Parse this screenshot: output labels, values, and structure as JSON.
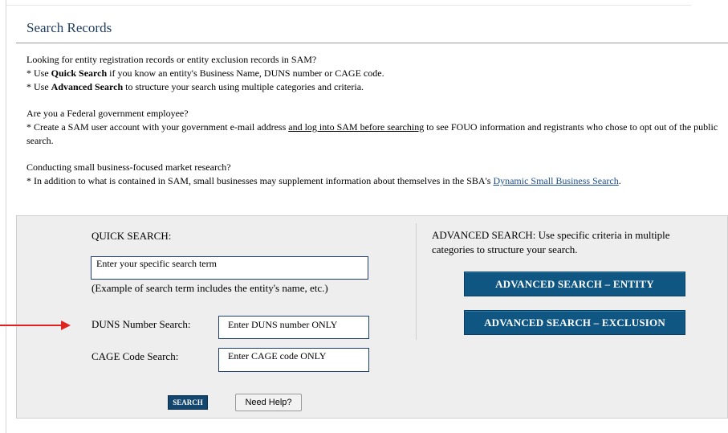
{
  "page": {
    "title": "Search Records"
  },
  "intro": {
    "line1": "Looking for entity registration records or entity exclusion records in SAM?",
    "quick_prefix": "* Use ",
    "quick_bold": "Quick Search",
    "quick_suffix": " if you know an entity's Business Name, DUNS number or CAGE code.",
    "adv_prefix": "* Use ",
    "adv_bold": "Advanced Search",
    "adv_suffix": " to structure your search using multiple categories and criteria.",
    "fed_q": "Are you a Federal government employee?",
    "fed_prefix": "* Create a SAM user account with your government e-mail address ",
    "fed_link": "and log into SAM before searching",
    "fed_suffix": " to see FOUO information and registrants who chose to opt out of the public search.",
    "small_q": "Conducting small business-focused market research?",
    "small_prefix": "* In addition to what is contained in SAM, small businesses may supplement information about themselves in the SBA's ",
    "small_link": "Dynamic Small Business Search",
    "small_suffix": "."
  },
  "quick_search": {
    "label": "QUICK SEARCH:",
    "term_placeholder": "Enter your specific search term",
    "example": "(Example of search term includes the entity's name, etc.)",
    "duns_label": "DUNS Number Search:",
    "duns_placeholder": "Enter DUNS number ONLY",
    "cage_label": "CAGE Code Search:",
    "cage_placeholder": "Enter CAGE code ONLY",
    "search_label": "SEARCH",
    "help_label": "Need Help?"
  },
  "advanced_search": {
    "text": "ADVANCED SEARCH: Use specific criteria in multiple categories to structure your search.",
    "entity_label": "ADVANCED SEARCH – ENTITY",
    "exclusion_label": "ADVANCED SEARCH – EXCLUSION"
  },
  "colors": {
    "accent": "#0f5682",
    "arrow": "#e0211f",
    "title": "#1f3b5e"
  },
  "icons": {
    "arrow": "red-arrow-icon"
  }
}
